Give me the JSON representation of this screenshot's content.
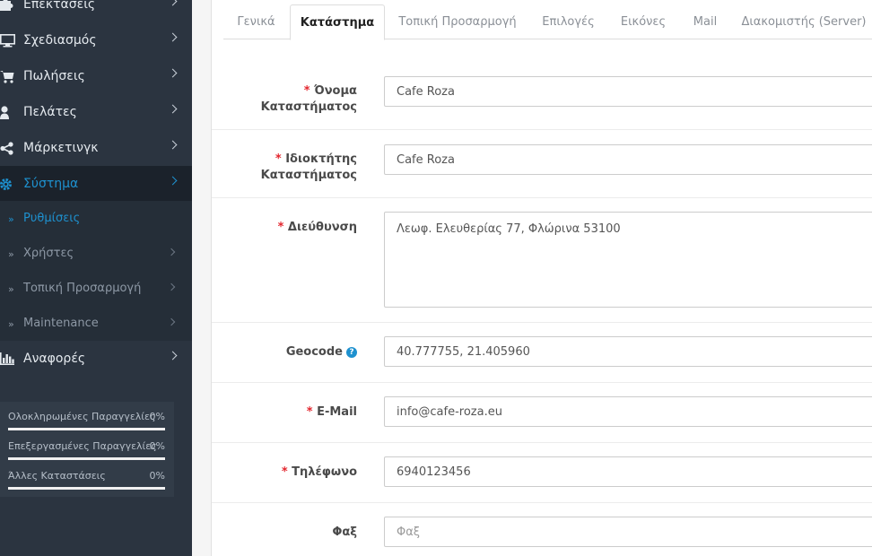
{
  "sidebar": {
    "menu": [
      {
        "label": "Επεκτάσεις",
        "icon": "puzzle-icon"
      },
      {
        "label": "Σχεδιασμός",
        "icon": "monitor-icon"
      },
      {
        "label": "Πωλήσεις",
        "icon": "cart-icon"
      },
      {
        "label": "Πελάτες",
        "icon": "user-icon"
      },
      {
        "label": "Μάρκετινγκ",
        "icon": "share-icon"
      },
      {
        "label": "Σύστημα",
        "icon": "gear-icon"
      }
    ],
    "submenu": [
      {
        "label": "Ρυθμίσεις"
      },
      {
        "label": "Χρήστες"
      },
      {
        "label": "Τοπική Προσαρμογή"
      },
      {
        "label": "Maintenance"
      }
    ],
    "reports": {
      "label": "Αναφορές",
      "icon": "bar-chart-icon"
    },
    "stats": [
      {
        "name": "Ολοκληρωμένες Παραγγελίες",
        "pct": "0%",
        "value": 0
      },
      {
        "name": "Επεξεργασμένες Παραγγελίες",
        "pct": "0%",
        "value": 0
      },
      {
        "name": "Άλλες Καταστάσεις",
        "pct": "0%",
        "value": 0
      }
    ],
    "colors": {
      "bg": "#2b3440",
      "active": "#1e91cf"
    }
  },
  "tabs": [
    "Γενικά",
    "Κατάστημα",
    "Τοπική Προσαρμογή",
    "Επιλογές",
    "Εικόνες",
    "Mail",
    "Διακομιστής (Server)"
  ],
  "active_tab": "Κατάστημα",
  "form": {
    "store_name": {
      "label_line1": "Όνομα",
      "label_line2": "Καταστήματος",
      "value": "Cafe Roza"
    },
    "owner": {
      "label_line1": "Ιδιοκτήτης",
      "label_line2": "Καταστήματος",
      "value": "Cafe Roza"
    },
    "address": {
      "label": "Διεύθυνση",
      "value": "Λεωφ. Ελευθερίας 77, Φλώρινα 53100"
    },
    "geocode": {
      "label": "Geocode",
      "help": "?",
      "value": "40.777755, 21.405960"
    },
    "email": {
      "label": "E-Mail",
      "value": "info@cafe-roza.eu"
    },
    "phone": {
      "label": "Τηλέφωνο",
      "value": "6940123456"
    },
    "fax": {
      "label": "Φαξ",
      "placeholder": "Φαξ"
    }
  },
  "required_mark": "*"
}
